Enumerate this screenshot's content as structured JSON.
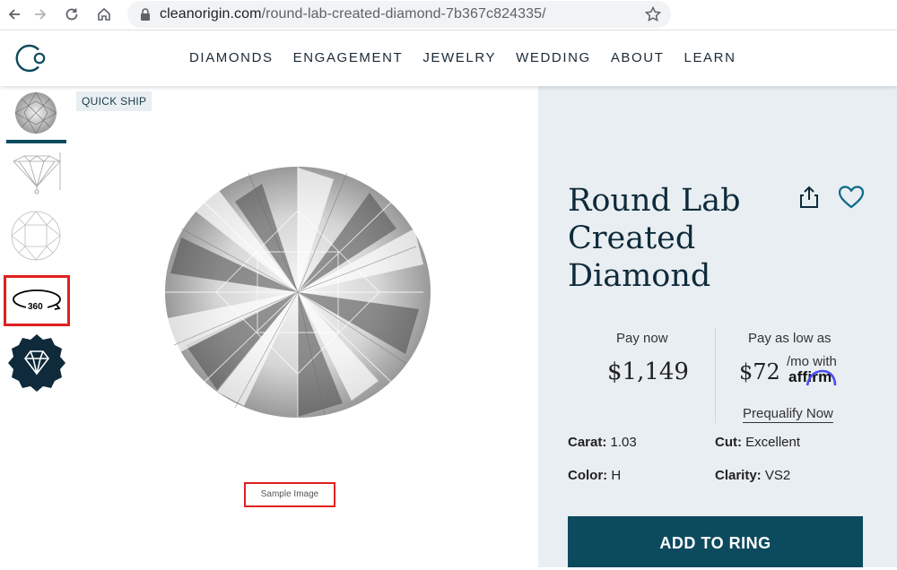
{
  "browser": {
    "url_domain": "cleanorigin.com",
    "url_path": "/round-lab-created-diamond-7b367c824335/"
  },
  "header": {
    "logo_letters": "Co",
    "nav": [
      "DIAMONDS",
      "ENGAGEMENT",
      "JEWELRY",
      "WEDDING",
      "ABOUT",
      "LEARN"
    ]
  },
  "gallery": {
    "badge": "QUICK SHIP",
    "view_360_label": "360",
    "sample_label": "Sample Image"
  },
  "product": {
    "title": "Round Lab Created Diamond",
    "pay_now_label": "Pay now",
    "pay_now_price": "$1,149",
    "pay_low_label": "Pay as low as",
    "monthly_price": "$72",
    "monthly_suffix": "/mo with",
    "affirm_brand": "affirm",
    "prequalify": "Prequalify Now",
    "specs": {
      "carat_label": "Carat:",
      "carat_value": "1.03",
      "cut_label": "Cut:",
      "cut_value": "Excellent",
      "color_label": "Color:",
      "color_value": "H",
      "clarity_label": "Clarity:",
      "clarity_value": "VS2"
    },
    "add_button": "ADD TO RING"
  },
  "colors": {
    "brand_teal": "#0c4a5e",
    "panel_bg": "#e8eef2",
    "highlight_red": "#e02020",
    "affirm_blue": "#4a4af4"
  }
}
